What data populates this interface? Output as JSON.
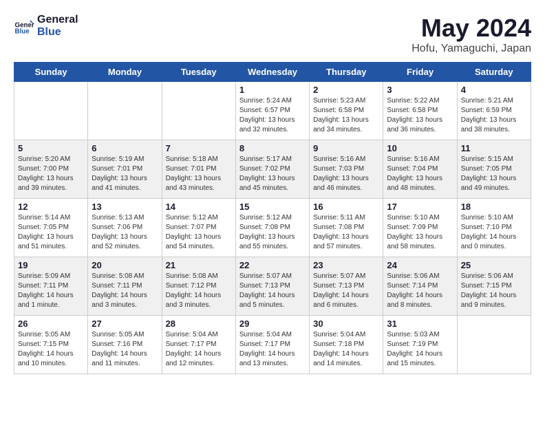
{
  "header": {
    "logo_line1": "General",
    "logo_line2": "Blue",
    "month": "May 2024",
    "location": "Hofu, Yamaguchi, Japan"
  },
  "weekdays": [
    "Sunday",
    "Monday",
    "Tuesday",
    "Wednesday",
    "Thursday",
    "Friday",
    "Saturday"
  ],
  "weeks": [
    [
      {
        "day": "",
        "info": ""
      },
      {
        "day": "",
        "info": ""
      },
      {
        "day": "",
        "info": ""
      },
      {
        "day": "1",
        "info": "Sunrise: 5:24 AM\nSunset: 6:57 PM\nDaylight: 13 hours\nand 32 minutes."
      },
      {
        "day": "2",
        "info": "Sunrise: 5:23 AM\nSunset: 6:58 PM\nDaylight: 13 hours\nand 34 minutes."
      },
      {
        "day": "3",
        "info": "Sunrise: 5:22 AM\nSunset: 6:58 PM\nDaylight: 13 hours\nand 36 minutes."
      },
      {
        "day": "4",
        "info": "Sunrise: 5:21 AM\nSunset: 6:59 PM\nDaylight: 13 hours\nand 38 minutes."
      }
    ],
    [
      {
        "day": "5",
        "info": "Sunrise: 5:20 AM\nSunset: 7:00 PM\nDaylight: 13 hours\nand 39 minutes."
      },
      {
        "day": "6",
        "info": "Sunrise: 5:19 AM\nSunset: 7:01 PM\nDaylight: 13 hours\nand 41 minutes."
      },
      {
        "day": "7",
        "info": "Sunrise: 5:18 AM\nSunset: 7:01 PM\nDaylight: 13 hours\nand 43 minutes."
      },
      {
        "day": "8",
        "info": "Sunrise: 5:17 AM\nSunset: 7:02 PM\nDaylight: 13 hours\nand 45 minutes."
      },
      {
        "day": "9",
        "info": "Sunrise: 5:16 AM\nSunset: 7:03 PM\nDaylight: 13 hours\nand 46 minutes."
      },
      {
        "day": "10",
        "info": "Sunrise: 5:16 AM\nSunset: 7:04 PM\nDaylight: 13 hours\nand 48 minutes."
      },
      {
        "day": "11",
        "info": "Sunrise: 5:15 AM\nSunset: 7:05 PM\nDaylight: 13 hours\nand 49 minutes."
      }
    ],
    [
      {
        "day": "12",
        "info": "Sunrise: 5:14 AM\nSunset: 7:05 PM\nDaylight: 13 hours\nand 51 minutes."
      },
      {
        "day": "13",
        "info": "Sunrise: 5:13 AM\nSunset: 7:06 PM\nDaylight: 13 hours\nand 52 minutes."
      },
      {
        "day": "14",
        "info": "Sunrise: 5:12 AM\nSunset: 7:07 PM\nDaylight: 13 hours\nand 54 minutes."
      },
      {
        "day": "15",
        "info": "Sunrise: 5:12 AM\nSunset: 7:08 PM\nDaylight: 13 hours\nand 55 minutes."
      },
      {
        "day": "16",
        "info": "Sunrise: 5:11 AM\nSunset: 7:08 PM\nDaylight: 13 hours\nand 57 minutes."
      },
      {
        "day": "17",
        "info": "Sunrise: 5:10 AM\nSunset: 7:09 PM\nDaylight: 13 hours\nand 58 minutes."
      },
      {
        "day": "18",
        "info": "Sunrise: 5:10 AM\nSunset: 7:10 PM\nDaylight: 14 hours\nand 0 minutes."
      }
    ],
    [
      {
        "day": "19",
        "info": "Sunrise: 5:09 AM\nSunset: 7:11 PM\nDaylight: 14 hours\nand 1 minute."
      },
      {
        "day": "20",
        "info": "Sunrise: 5:08 AM\nSunset: 7:11 PM\nDaylight: 14 hours\nand 3 minutes."
      },
      {
        "day": "21",
        "info": "Sunrise: 5:08 AM\nSunset: 7:12 PM\nDaylight: 14 hours\nand 3 minutes."
      },
      {
        "day": "22",
        "info": "Sunrise: 5:07 AM\nSunset: 7:13 PM\nDaylight: 14 hours\nand 5 minutes."
      },
      {
        "day": "23",
        "info": "Sunrise: 5:07 AM\nSunset: 7:13 PM\nDaylight: 14 hours\nand 6 minutes."
      },
      {
        "day": "24",
        "info": "Sunrise: 5:06 AM\nSunset: 7:14 PM\nDaylight: 14 hours\nand 8 minutes."
      },
      {
        "day": "25",
        "info": "Sunrise: 5:06 AM\nSunset: 7:15 PM\nDaylight: 14 hours\nand 9 minutes."
      }
    ],
    [
      {
        "day": "26",
        "info": "Sunrise: 5:05 AM\nSunset: 7:15 PM\nDaylight: 14 hours\nand 10 minutes."
      },
      {
        "day": "27",
        "info": "Sunrise: 5:05 AM\nSunset: 7:16 PM\nDaylight: 14 hours\nand 11 minutes."
      },
      {
        "day": "28",
        "info": "Sunrise: 5:04 AM\nSunset: 7:17 PM\nDaylight: 14 hours\nand 12 minutes."
      },
      {
        "day": "29",
        "info": "Sunrise: 5:04 AM\nSunset: 7:17 PM\nDaylight: 14 hours\nand 13 minutes."
      },
      {
        "day": "30",
        "info": "Sunrise: 5:04 AM\nSunset: 7:18 PM\nDaylight: 14 hours\nand 14 minutes."
      },
      {
        "day": "31",
        "info": "Sunrise: 5:03 AM\nSunset: 7:19 PM\nDaylight: 14 hours\nand 15 minutes."
      },
      {
        "day": "",
        "info": ""
      }
    ]
  ]
}
